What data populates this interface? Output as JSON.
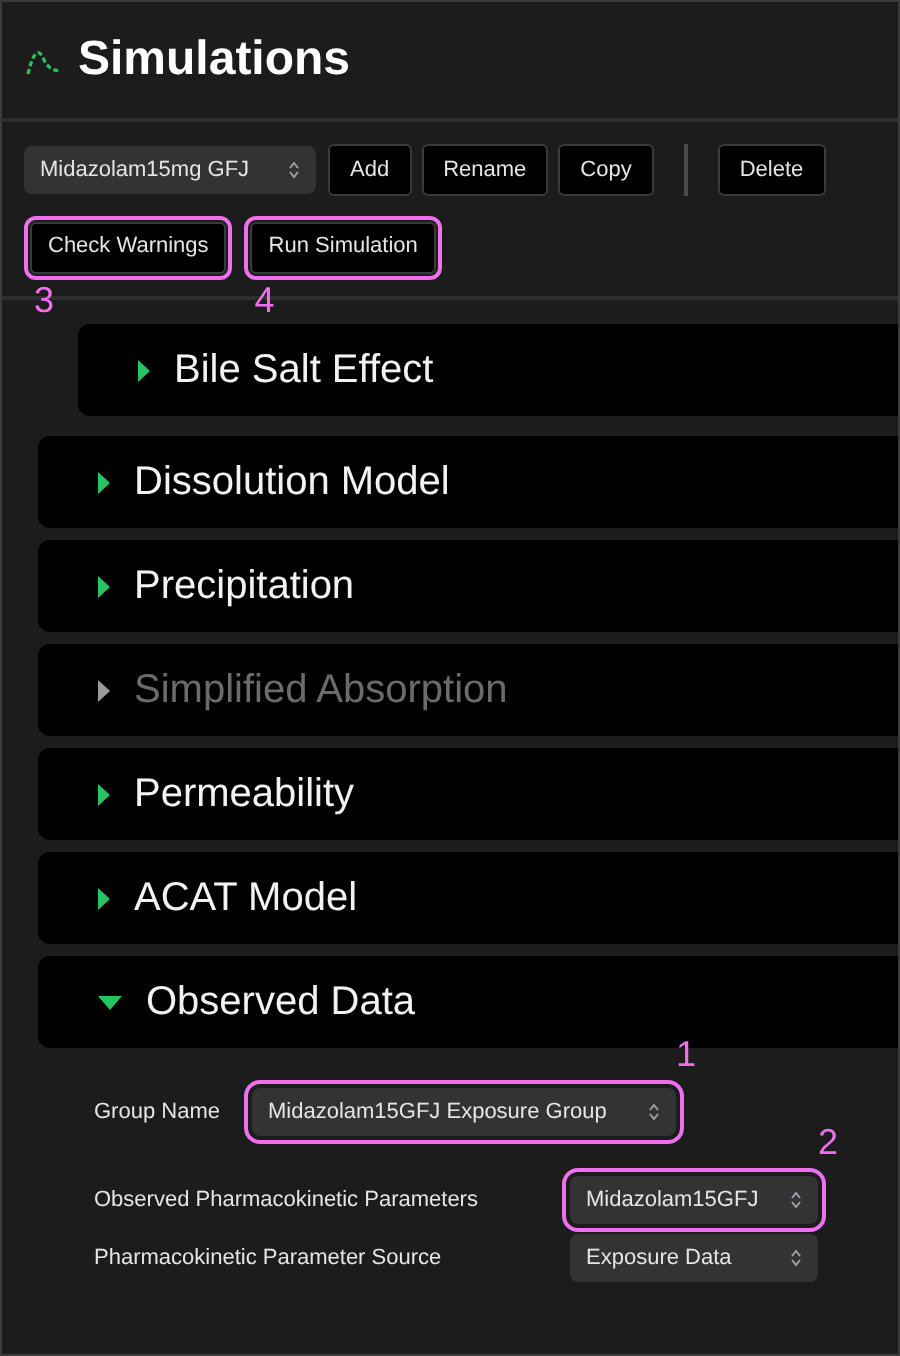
{
  "title": "Simulations",
  "toolbar": {
    "simulation_select": {
      "value": "Midazolam15mg GFJ"
    },
    "buttons": [
      "Add",
      "Rename",
      "Copy"
    ],
    "danger_buttons": [
      "Delete"
    ]
  },
  "actions": [
    {
      "label": "Check Warnings",
      "callout": "3"
    },
    {
      "label": "Run Simulation",
      "callout": "4"
    }
  ],
  "sections": [
    {
      "label": "Bile Salt Effect",
      "kind": "sub",
      "expanded": false,
      "disabled": false
    },
    {
      "label": "Dissolution Model",
      "kind": "main",
      "expanded": false,
      "disabled": false
    },
    {
      "label": "Precipitation",
      "kind": "main",
      "expanded": false,
      "disabled": false
    },
    {
      "label": "Simplified Absorption",
      "kind": "main",
      "expanded": false,
      "disabled": true
    },
    {
      "label": "Permeability",
      "kind": "main",
      "expanded": false,
      "disabled": false
    },
    {
      "label": "ACAT Model",
      "kind": "main",
      "expanded": false,
      "disabled": false
    },
    {
      "label": "Observed Data",
      "kind": "main",
      "expanded": true,
      "disabled": false
    }
  ],
  "observed_data": {
    "group": {
      "label": "Group Name",
      "value": "Midazolam15GFJ Exposure Group",
      "callout": "1"
    },
    "fields": [
      {
        "label": "Observed Pharmacokinetic Parameters",
        "value": "Midazolam15GFJ",
        "callout": "2"
      },
      {
        "label": "Pharmacokinetic Parameter Source",
        "value": "Exposure Data"
      }
    ]
  }
}
